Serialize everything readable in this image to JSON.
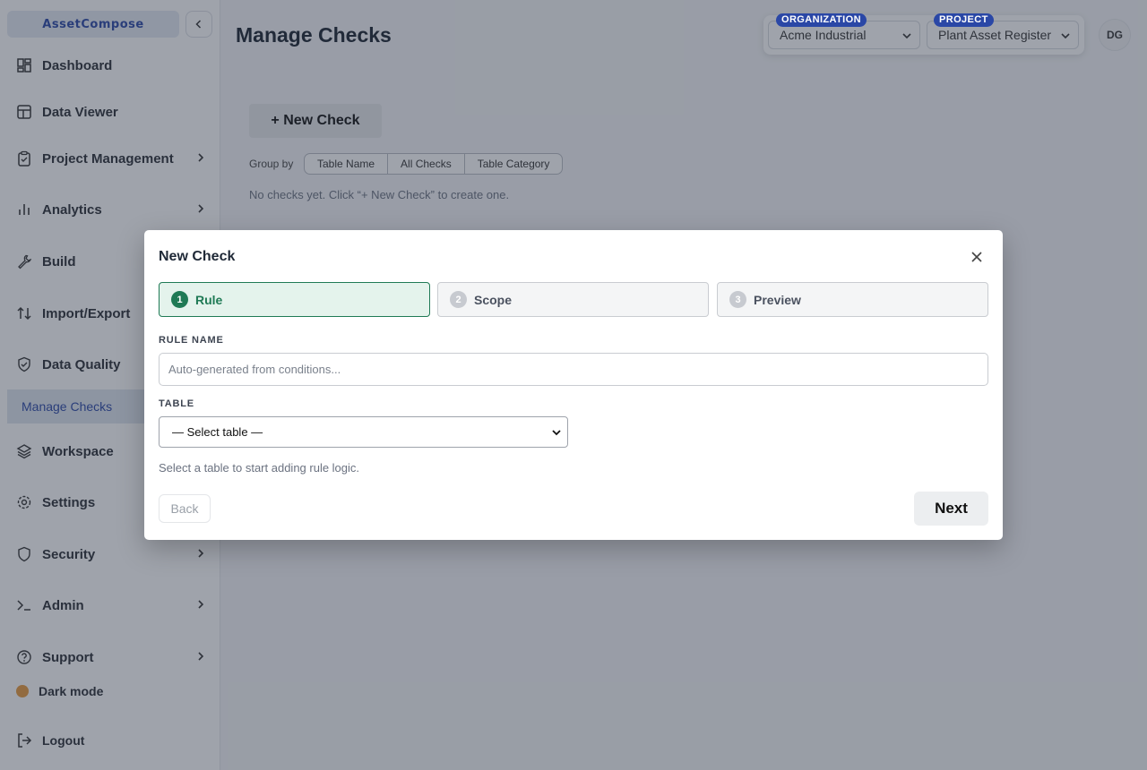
{
  "sidebar": {
    "brand": "AssetCompose",
    "items": [
      {
        "label": "Dashboard",
        "icon": "dashboard-icon"
      },
      {
        "label": "Data Viewer",
        "icon": "table-icon"
      },
      {
        "label": "Project Management",
        "icon": "clipboard-icon"
      },
      {
        "label": "Analytics",
        "icon": "bar-chart-icon"
      },
      {
        "label": "Build",
        "icon": "wrench-icon"
      },
      {
        "label": "Import/Export",
        "icon": "arrows-updown-icon"
      },
      {
        "label": "Data Quality",
        "icon": "shield-check-icon"
      },
      {
        "label": "Workspace",
        "icon": "layers-icon"
      },
      {
        "label": "Settings",
        "icon": "gear-icon"
      },
      {
        "label": "Security",
        "icon": "shield-icon"
      },
      {
        "label": "Admin",
        "icon": "terminal-icon"
      },
      {
        "label": "Support",
        "icon": "help-circle-icon"
      }
    ],
    "active_sub": "Manage Checks",
    "dark_mode": "Dark mode",
    "logout": "Logout"
  },
  "header": {
    "title": "Manage Checks",
    "org_label": "ORGANIZATION",
    "org_value": "Acme Industrial",
    "project_label": "PROJECT",
    "project_value": "Plant Asset Register",
    "avatar": "DG"
  },
  "main": {
    "new_check": "+ New Check",
    "group_by": "Group by",
    "group_options": [
      "Table Name",
      "All Checks",
      "Table Category"
    ],
    "empty": "No checks yet. Click “+ New Check” to create one."
  },
  "modal": {
    "title": "New Check",
    "steps": [
      {
        "num": "1",
        "label": "Rule"
      },
      {
        "num": "2",
        "label": "Scope"
      },
      {
        "num": "3",
        "label": "Preview"
      }
    ],
    "rule_name_label": "RULE NAME",
    "rule_name_placeholder": "Auto-generated from conditions...",
    "table_label": "TABLE",
    "table_value": "— Select table —",
    "hint": "Select a table to start adding rule logic.",
    "back": "Back",
    "next": "Next"
  },
  "colors": {
    "accent": "#2a47a6",
    "step_active": "#1f7a55"
  }
}
